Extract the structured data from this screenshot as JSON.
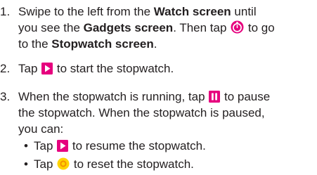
{
  "colors": {
    "icon_pink": "#e6007e",
    "icon_yellow": "#ffd400",
    "icon_orange": "#f39200",
    "text": "#231f20"
  },
  "steps": [
    {
      "number": "1.",
      "l1_a": "Swipe to the left from the ",
      "l1_b": "Watch screen",
      "l1_c": " until",
      "l2_a": "you see the ",
      "l2_b": "Gadgets screen",
      "l2_c": ". Then tap ",
      "l2_icon": "stopwatch-icon",
      "l2_d": " to go",
      "l3_a": "to the ",
      "l3_b": "Stopwatch screen",
      "l3_c": "."
    },
    {
      "number": "2.",
      "l1_a": "Tap ",
      "l1_icon": "play-icon",
      "l1_b": " to start the stopwatch."
    },
    {
      "number": "3.",
      "l1_a": "When the stopwatch is running, tap ",
      "l1_icon": "pause-icon",
      "l1_b": " to pause",
      "l2": "the stopwatch. When the stopwatch is paused,",
      "l3": "you can:",
      "bullets": [
        {
          "dot": "•",
          "a": "Tap ",
          "icon": "play-icon",
          "b": " to resume the stopwatch."
        },
        {
          "dot": "•",
          "a": "Tap ",
          "icon": "reset-icon",
          "b": " to reset the stopwatch."
        }
      ]
    }
  ]
}
